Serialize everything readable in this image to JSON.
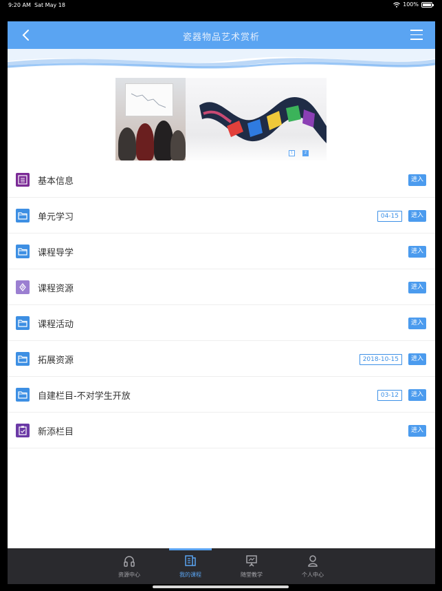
{
  "status_bar": {
    "time": "9:20 AM",
    "date": "Sat May 18",
    "battery": "100%"
  },
  "navbar": {
    "title": "瓷器物品艺术赏析",
    "back_icon": "chevron-left-icon",
    "menu_icon": "hamburger-menu-icon"
  },
  "banner": {
    "page_dots": [
      "1",
      "2"
    ],
    "active_dot": 1
  },
  "list": {
    "enter_label": "进入",
    "items": [
      {
        "label": "基本信息",
        "icon": "info-list-icon",
        "date": ""
      },
      {
        "label": "单元学习",
        "icon": "folder-icon",
        "date": "04-15"
      },
      {
        "label": "课程导学",
        "icon": "folder-icon",
        "date": ""
      },
      {
        "label": "课程资源",
        "icon": "resource-icon",
        "date": ""
      },
      {
        "label": "课程活动",
        "icon": "folder-icon",
        "date": ""
      },
      {
        "label": "拓展资源",
        "icon": "folder-icon",
        "date": "2018-10-15"
      },
      {
        "label": "自建栏目-不对学生开放",
        "icon": "folder-icon",
        "date": "03-12"
      },
      {
        "label": "新添栏目",
        "icon": "clipboard-check-icon",
        "date": ""
      }
    ]
  },
  "tabbar": {
    "tabs": [
      {
        "label": "资源中心",
        "icon": "headphones-icon",
        "active": false
      },
      {
        "label": "我的课程",
        "icon": "book-icon",
        "active": true
      },
      {
        "label": "随堂教学",
        "icon": "presentation-icon",
        "active": false
      },
      {
        "label": "个人中心",
        "icon": "person-icon",
        "active": false
      }
    ]
  },
  "colors": {
    "accent": "#5aa4f2",
    "enter_button": "#4b9bee",
    "tabbar_bg": "#2a2a2e"
  }
}
